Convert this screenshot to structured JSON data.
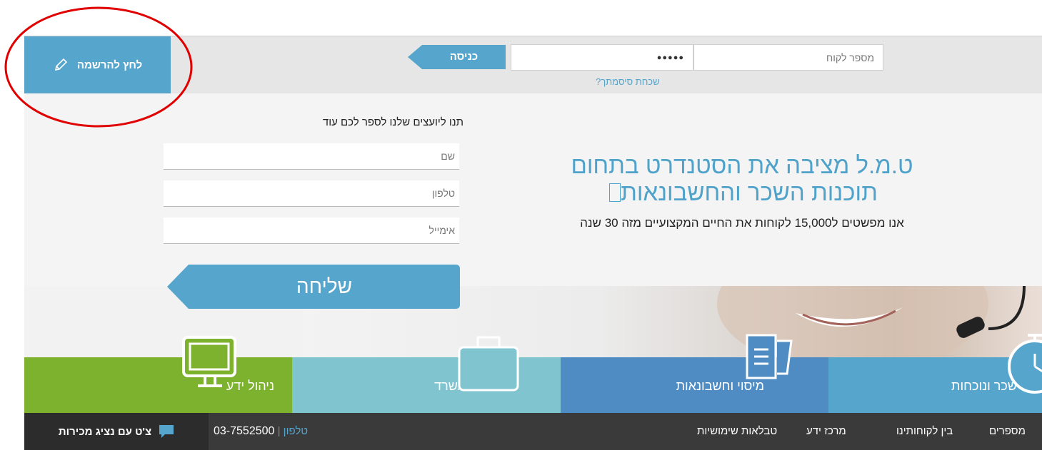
{
  "header": {
    "signup_label": "לחץ להרשמה",
    "login_button": "כניסה",
    "customer_number_placeholder": "מספר לקוח",
    "password_value": "●●●●●",
    "forgot_password": "שכחת סיסמתך?"
  },
  "contact_form": {
    "title": "תנו ליועצים שלנו לספר לכם עוד",
    "name_placeholder": "שם",
    "phone_placeholder": "טלפון",
    "email_placeholder": "אימייל",
    "send_label": "שליחה"
  },
  "hero": {
    "headline_line1": "ט.מ.ל מציבה את הסטנדרט בתחום",
    "headline_line2": "תוכנות השכר והחשבונאות",
    "subline": "אנו מפשטים ל15,000 לקוחות את החיים המקצועיים מזה 30 שנה"
  },
  "tiles": [
    {
      "label": "ניהול ידע",
      "color": "#7cb22e",
      "icon": "monitor-icon"
    },
    {
      "label": "ניהול משרד",
      "color": "#7fc4cf",
      "icon": "briefcase-icon"
    },
    {
      "label": "מיסוי וחשבונאות",
      "color": "#4f8cc4",
      "icon": "document-icon"
    },
    {
      "label": "שכר ונוכחות",
      "color": "#56a5cc",
      "icon": "stopwatch-icon"
    }
  ],
  "bottom_bar": {
    "chat_label": "צ'ט עם נציג מכירות",
    "phone_label": "טלפון",
    "phone_number": "03-7552500",
    "nav": [
      "טבלאות שימושיות",
      "מרכז ידע",
      "בין לקוחותינו",
      "מספרים"
    ]
  },
  "annotation": {
    "color": "#e00000"
  },
  "colors": {
    "accent": "#56a5cc",
    "headline": "#4fa2c9"
  }
}
